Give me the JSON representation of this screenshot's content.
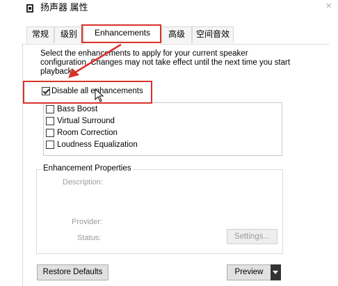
{
  "window": {
    "title": "扬声器 属性"
  },
  "tabs": [
    {
      "label": "常规",
      "active": false
    },
    {
      "label": "级别",
      "active": false
    },
    {
      "label": "Enhancements",
      "active": true
    },
    {
      "label": "高级",
      "active": false
    },
    {
      "label": "空间音效",
      "active": false
    }
  ],
  "enhancements": {
    "description_lines": [
      "Select the enhancements to apply for your current speaker",
      "configuration. Changes may not take effect until the next time you start",
      "playback."
    ],
    "disable_all": {
      "label": "Disable all enhancements",
      "checked": true
    },
    "items": [
      {
        "label": "Bass Boost",
        "checked": false
      },
      {
        "label": "Virtual Surround",
        "checked": false
      },
      {
        "label": "Room Correction",
        "checked": false
      },
      {
        "label": "Loudness Equalization",
        "checked": false
      }
    ]
  },
  "properties": {
    "group_label": "Enhancement Properties",
    "description_label": "Description:",
    "provider_label": "Provider:",
    "status_label": "Status:",
    "settings_button": "Settings..."
  },
  "footer": {
    "restore_button": "Restore Defaults",
    "preview_button": "Preview"
  },
  "colors": {
    "annotation_red": "#d9302a",
    "disabled_text": "#9a9a9a"
  }
}
